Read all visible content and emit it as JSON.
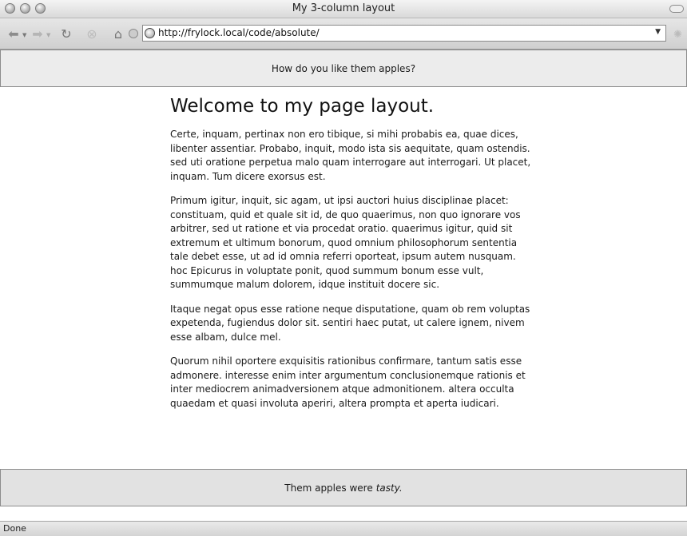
{
  "window": {
    "title": "My 3-column layout"
  },
  "toolbar": {
    "url": "http://frylock.local/code/absolute/"
  },
  "page": {
    "header_text": "How do you like them apples?",
    "heading": "Welcome to my page layout.",
    "paragraphs": [
      "Certe, inquam, pertinax non ero tibique, si mihi probabis ea, quae dices, libenter assentiar. Probabo, inquit, modo ista sis aequitate, quam ostendis. sed uti oratione perpetua malo quam interrogare aut interrogari. Ut placet, inquam. Tum dicere exorsus est.",
      "Primum igitur, inquit, sic agam, ut ipsi auctori huius disciplinae placet: constituam, quid et quale sit id, de quo quaerimus, non quo ignorare vos arbitrer, sed ut ratione et via procedat oratio. quaerimus igitur, quid sit extremum et ultimum bonorum, quod omnium philosophorum sententia tale debet esse, ut ad id omnia referri oporteat, ipsum autem nusquam. hoc Epicurus in voluptate ponit, quod summum bonum esse vult, summumque malum dolorem, idque instituit docere sic.",
      "Itaque negat opus esse ratione neque disputatione, quam ob rem voluptas expetenda, fugiendus dolor sit. sentiri haec putat, ut calere ignem, nivem esse albam, dulce mel.",
      "Quorum nihil oportere exquisitis rationibus confirmare, tantum satis esse admonere. interesse enim inter argumentum conclusionemque rationis et inter mediocrem animadversionem atque admonitionem. altera occulta quaedam et quasi involuta aperiri, altera prompta et aperta iudicari."
    ],
    "footer_text": "Them apples were",
    "footer_emphasis": "tasty."
  },
  "statusbar": {
    "text": "Done"
  },
  "icons": {
    "back": "back-arrow-icon",
    "forward": "forward-arrow-icon",
    "reload": "reload-icon",
    "stop": "stop-icon",
    "home": "home-icon",
    "globe": "globe-icon"
  }
}
